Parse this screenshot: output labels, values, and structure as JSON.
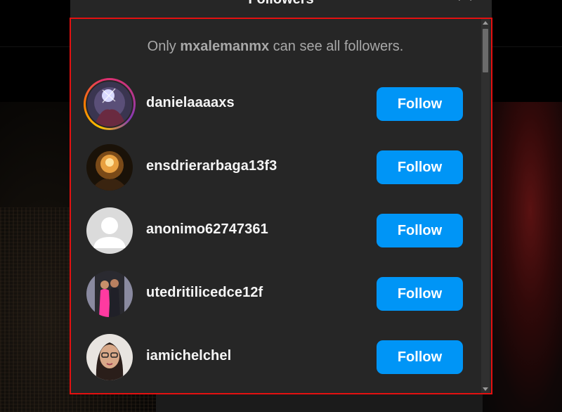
{
  "dialog": {
    "title": "Followers",
    "notice_prefix": "Only ",
    "notice_account": "mxalemanmx",
    "notice_suffix": " can see all followers."
  },
  "followers": [
    {
      "username": "danielaaaaxs",
      "button": "Follow",
      "avatar": "photo-avatar",
      "story_ring": true
    },
    {
      "username": "ensdrierarbaga13f3",
      "button": "Follow",
      "avatar": "photo-avatar",
      "story_ring": false
    },
    {
      "username": "anonimo62747361",
      "button": "Follow",
      "avatar": "default-avatar",
      "story_ring": false
    },
    {
      "username": "utedritilicedce12f",
      "button": "Follow",
      "avatar": "photo-avatar",
      "story_ring": false
    },
    {
      "username": "iamichelchel",
      "button": "Follow",
      "avatar": "photo-avatar",
      "story_ring": false
    }
  ],
  "colors": {
    "accent": "#0095f6",
    "dialog_bg": "#262626",
    "highlight_border": "#e41010"
  }
}
